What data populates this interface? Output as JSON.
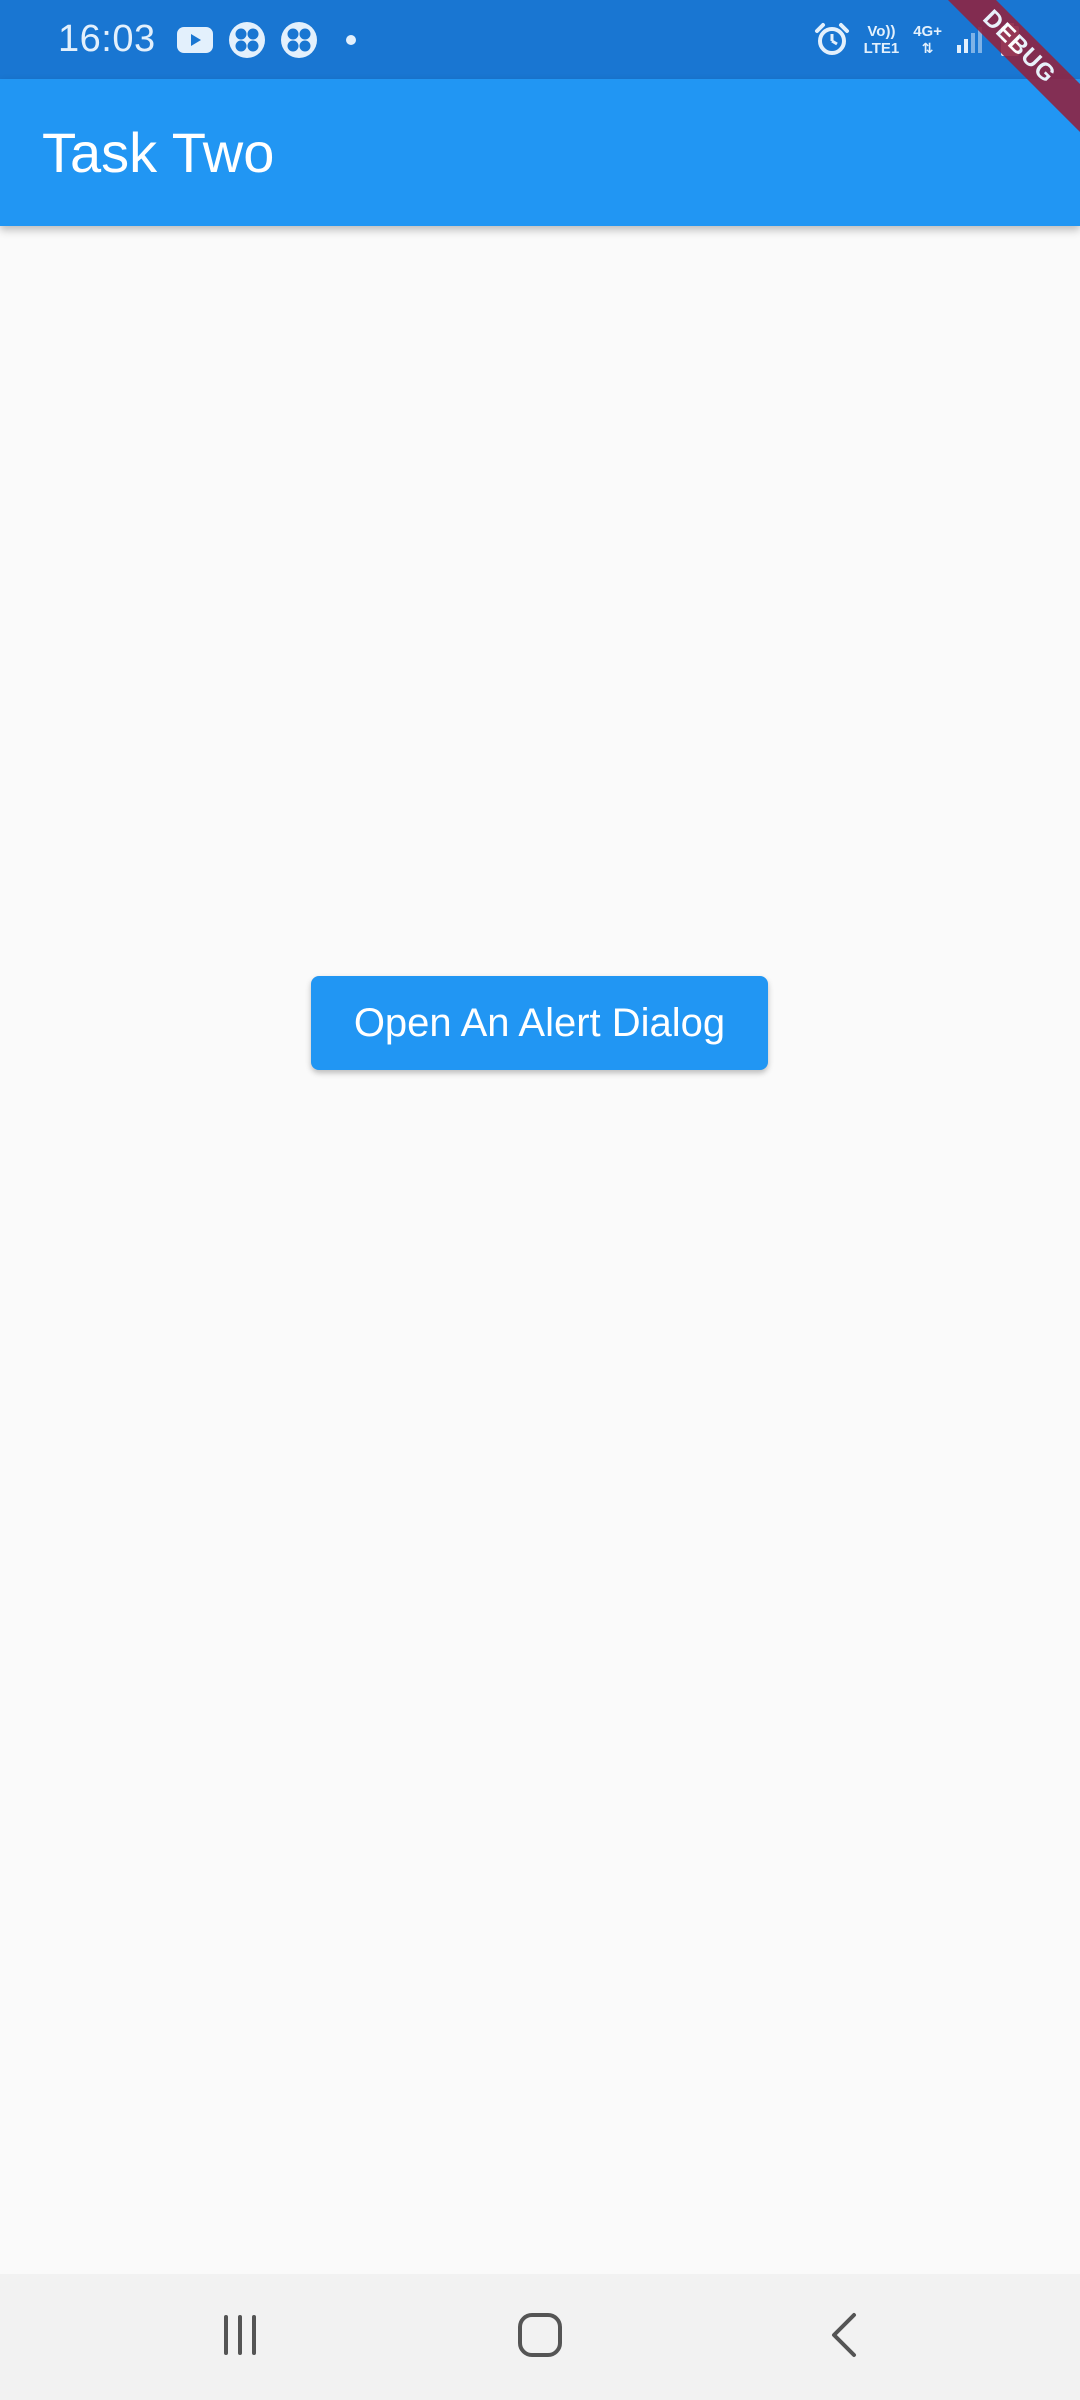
{
  "status_bar": {
    "time": "16:03",
    "left_icons": [
      "youtube-icon",
      "fan-app-icon",
      "fan-app-icon"
    ],
    "network_top": "Vo))",
    "network_bottom": "LTE1",
    "signal_type": "4G+",
    "right_icons": [
      "alarm-icon",
      "signal-icon",
      "battery-icon"
    ]
  },
  "app_bar": {
    "title": "Task Two"
  },
  "debug_banner": {
    "label": "DEBUG"
  },
  "main": {
    "button_label": "Open An Alert Dialog"
  },
  "nav_bar": {
    "icons": [
      "recent-apps-icon",
      "home-icon",
      "back-icon"
    ]
  },
  "colors": {
    "primary": "#2196f3",
    "status_bar": "#1976d2",
    "background": "#fafafa",
    "debug_banner": "#8e2443"
  }
}
